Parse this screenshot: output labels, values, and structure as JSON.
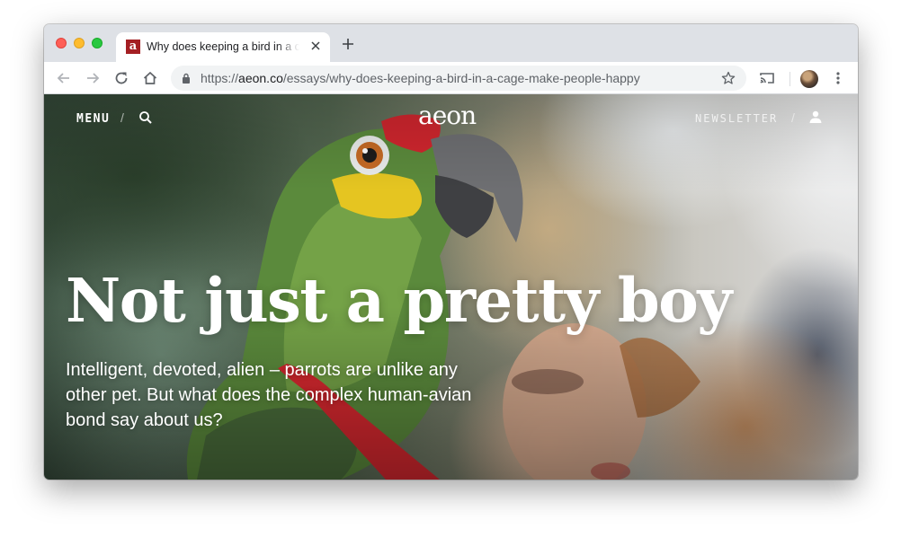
{
  "browser": {
    "tab": {
      "favicon_letter": "a",
      "title": "Why does keeping a bird in a cage make people happy"
    },
    "toolbar": {
      "url_scheme": "https://",
      "url_host": "aeon.co",
      "url_path": "/essays/why-does-keeping-a-bird-in-a-cage-make-people-happy"
    }
  },
  "site": {
    "menu_label": "MENU",
    "divider": "/",
    "logo": "aeon",
    "newsletter_label": "NEWSLETTER"
  },
  "article": {
    "headline": "Not just a pretty boy",
    "standfirst": "Intelligent, devoted, alien – parrots are unlike any other pet. But what does the complex human-avian bond say about us?"
  },
  "icons": [
    "back-arrow-icon",
    "forward-arrow-icon",
    "reload-icon",
    "home-icon",
    "lock-icon",
    "bookmark-star-icon",
    "cast-icon",
    "kebab-menu-icon",
    "search-icon",
    "user-icon",
    "close-icon",
    "plus-icon"
  ],
  "colors": {
    "favicon_bg": "#a41f23",
    "tabstrip_bg": "#dee1e6",
    "omnibox_bg": "#f1f3f4"
  }
}
